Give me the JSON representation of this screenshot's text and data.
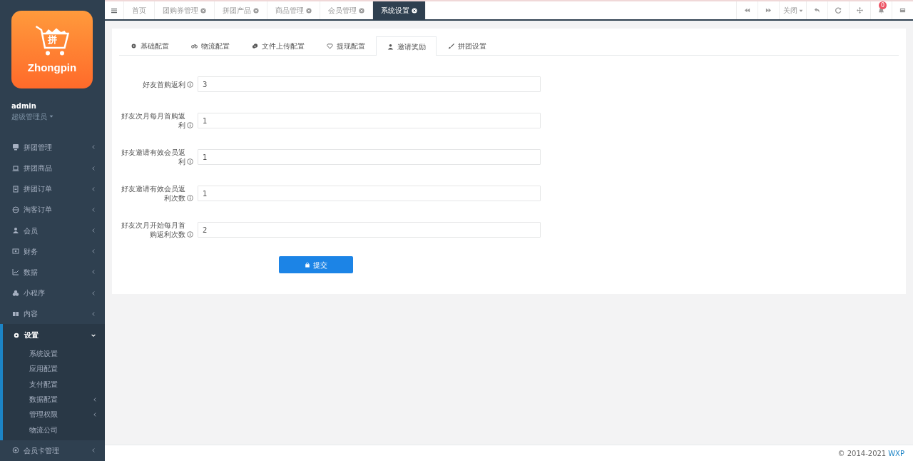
{
  "logo": {
    "text": "Zhongpin",
    "badge_char": "拼"
  },
  "user": {
    "name": "admin",
    "role": "超级管理员"
  },
  "sidebar": {
    "items": [
      {
        "label": "拼团管理",
        "expanded": false
      },
      {
        "label": "拼团商品",
        "expanded": false
      },
      {
        "label": "拼团订单",
        "expanded": false
      },
      {
        "label": "淘客订单",
        "expanded": false
      },
      {
        "label": "会员",
        "expanded": false
      },
      {
        "label": "财务",
        "expanded": false
      },
      {
        "label": "数据",
        "expanded": false
      },
      {
        "label": "小程序",
        "expanded": false
      },
      {
        "label": "内容",
        "expanded": false
      },
      {
        "label": "设置",
        "expanded": true,
        "children": [
          {
            "label": "系统设置",
            "has_children": false
          },
          {
            "label": "应用配置",
            "has_children": false
          },
          {
            "label": "支付配置",
            "has_children": false
          },
          {
            "label": "数据配置",
            "has_children": true
          },
          {
            "label": "管理权限",
            "has_children": true
          },
          {
            "label": "物流公司",
            "has_children": false
          }
        ]
      },
      {
        "label": "会员卡管理",
        "expanded": false
      }
    ]
  },
  "page_tabs": [
    {
      "label": "首页",
      "closable": false,
      "selected": false
    },
    {
      "label": "团购券管理",
      "closable": true,
      "selected": false
    },
    {
      "label": "拼团产品",
      "closable": true,
      "selected": false
    },
    {
      "label": "商品管理",
      "closable": true,
      "selected": false
    },
    {
      "label": "会员管理",
      "closable": true,
      "selected": false
    },
    {
      "label": "系统设置",
      "closable": true,
      "selected": true
    }
  ],
  "toolbar": {
    "close_label": "关闭",
    "notification_count": "0"
  },
  "config_tabs": [
    {
      "label": "基础配置",
      "selected": false
    },
    {
      "label": "物流配置",
      "selected": false
    },
    {
      "label": "文件上传配置",
      "selected": false
    },
    {
      "label": "提现配置",
      "selected": false
    },
    {
      "label": "邀请奖励",
      "selected": true
    },
    {
      "label": "拼团设置",
      "selected": false
    }
  ],
  "form": {
    "fields": [
      {
        "label": "好友首购返利",
        "value": "3"
      },
      {
        "label": "好友次月每月首购返利",
        "value": "1"
      },
      {
        "label": "好友邀请有效会员返利",
        "value": "1"
      },
      {
        "label": "好友邀请有效会员返利次数",
        "value": "1"
      },
      {
        "label": "好友次月开始每月首购返利次数",
        "value": "2"
      }
    ],
    "submit": "提交"
  },
  "footer": {
    "copyright": "© 2014-2021",
    "link": "WXP"
  }
}
